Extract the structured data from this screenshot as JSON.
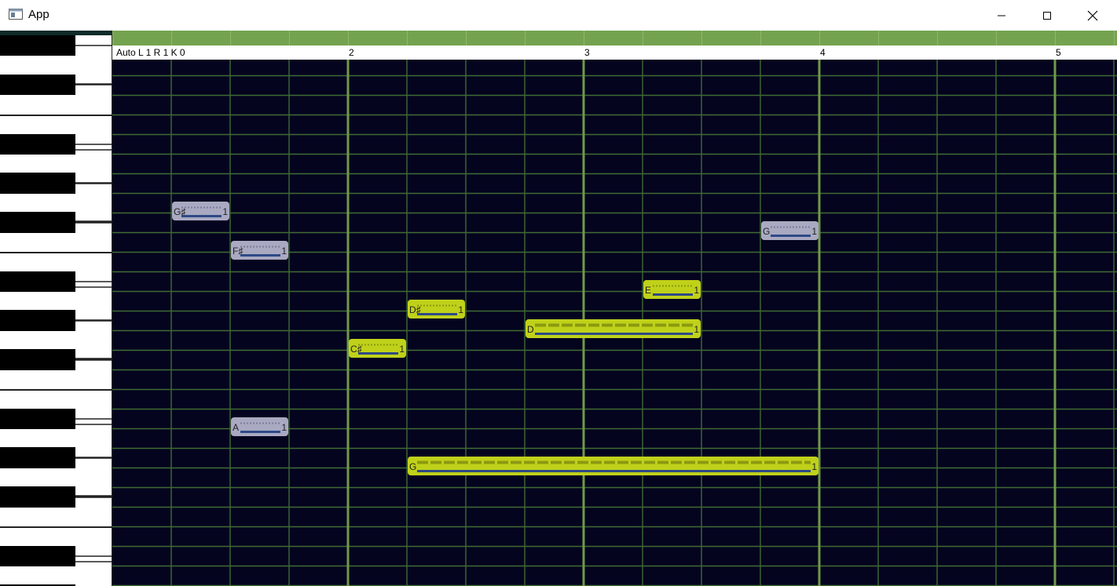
{
  "window": {
    "title": "App",
    "controls": {
      "minimize": "minimize-icon",
      "maximize": "maximize-icon",
      "close": "close-icon"
    }
  },
  "ruler": {
    "status": "Auto L 1 R 1 K 0",
    "bars": [
      {
        "label": "2",
        "beat": 4
      },
      {
        "label": "3",
        "beat": 8
      },
      {
        "label": "4",
        "beat": 12
      },
      {
        "label": "5",
        "beat": 16
      }
    ]
  },
  "keyboard": {
    "visible_octaves": 5,
    "black_key_color": "#000000",
    "white_key_color": "#ffffff"
  },
  "piano_roll": {
    "background": "#05041f",
    "grid_color": "#3f6b32",
    "bar_line_color": "#6f9a4a",
    "header_color": "#74a350",
    "selected_note_color": "#c0d11a",
    "unselected_note_color": "#a9a9c2",
    "velocity_bar_color": "#2e4a86",
    "notes": [
      {
        "label": "G♯",
        "value": "1",
        "row": 8,
        "start": 1,
        "length": 1,
        "selected": false
      },
      {
        "label": "G",
        "value": "1",
        "row": 9,
        "start": 11,
        "length": 1,
        "selected": false
      },
      {
        "label": "F♯",
        "value": "1",
        "row": 10,
        "start": 2,
        "length": 1,
        "selected": false
      },
      {
        "label": "E",
        "value": "1",
        "row": 12,
        "start": 9,
        "length": 1,
        "selected": true
      },
      {
        "label": "D♯",
        "value": "1",
        "row": 13,
        "start": 5,
        "length": 1,
        "selected": true
      },
      {
        "label": "D",
        "value": "1",
        "row": 14,
        "start": 7,
        "length": 3,
        "selected": true
      },
      {
        "label": "C♯",
        "value": "1",
        "row": 15,
        "start": 4,
        "length": 1,
        "selected": true
      },
      {
        "label": "A",
        "value": "1",
        "row": 19,
        "start": 2,
        "length": 1,
        "selected": false
      },
      {
        "label": "G",
        "value": "1",
        "row": 21,
        "start": 5,
        "length": 7,
        "selected": true
      }
    ]
  }
}
